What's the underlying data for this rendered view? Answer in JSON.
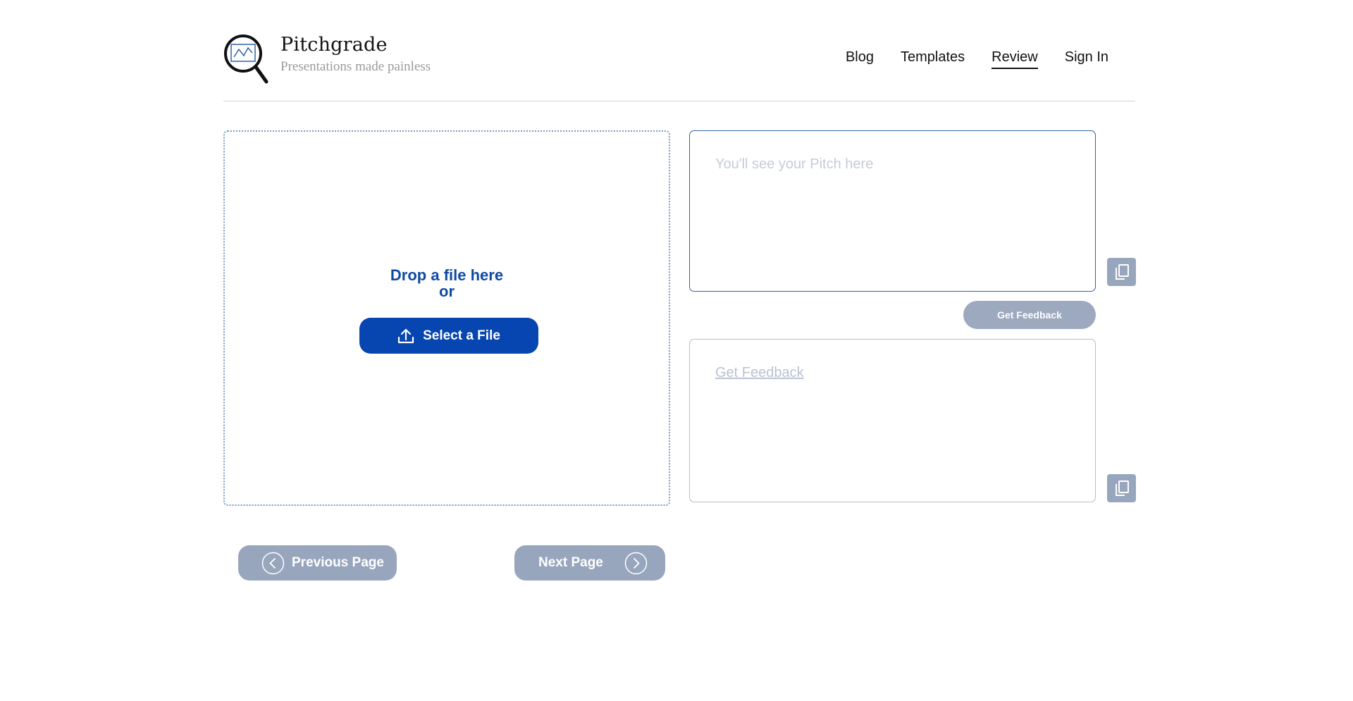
{
  "brand": {
    "name": "Pitchgrade",
    "tagline": "Presentations made painless"
  },
  "nav": {
    "items": [
      {
        "label": "Blog",
        "active": false
      },
      {
        "label": "Templates",
        "active": false
      },
      {
        "label": "Review",
        "active": true
      },
      {
        "label": "Sign In",
        "active": false
      }
    ]
  },
  "upload": {
    "drop_text": "Drop a file here",
    "or_text": "or",
    "select_label": "Select a File",
    "icon": "upload-icon"
  },
  "pitch": {
    "placeholder": "You'll see your Pitch here",
    "copy_icon": "copy-icon"
  },
  "feedback": {
    "button_label": "Get Feedback",
    "link_label": "Get Feedback",
    "copy_icon": "copy-icon"
  },
  "pager": {
    "prev_label": "Previous Page",
    "next_label": "Next Page",
    "prev_icon": "chevron-left-icon",
    "next_icon": "chevron-right-icon"
  },
  "colors": {
    "accent": "#0745b0",
    "drop_text": "#0f4aa3",
    "disabled_button": "#98a6bd",
    "border_blue": "#2f64a8"
  }
}
